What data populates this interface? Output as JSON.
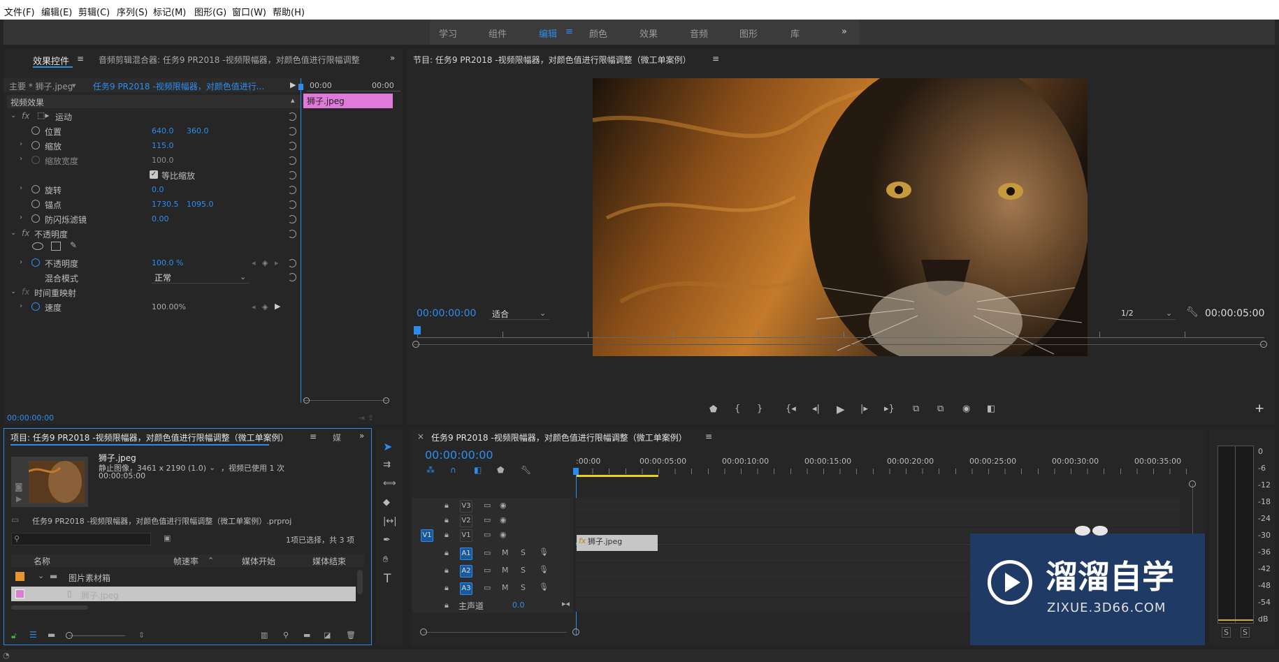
{
  "menu": [
    "文件(F)",
    "编辑(E)",
    "剪辑(C)",
    "序列(S)",
    "标记(M)",
    "图形(G)",
    "窗口(W)",
    "帮助(H)"
  ],
  "workspaces": [
    "学习",
    "组件",
    "编辑",
    "颜色",
    "效果",
    "音频",
    "图形",
    "库"
  ],
  "workspace_active": "编辑",
  "effect_controls": {
    "tab": "效果控件",
    "tab2": "音频剪辑混合器: 任务9 PR2018 -视频限幅器，对颜色值进行限幅调整",
    "master": "主要 * 狮子.jpeg",
    "sequence": "任务9 PR2018 -视频限幅器，对颜色值进行...",
    "time_start": "00:00",
    "time_end": "00:00",
    "clip": "狮子.jpeg",
    "section": "视频效果",
    "motion": "运动",
    "position_label": "位置",
    "position_x": "640.0",
    "position_y": "360.0",
    "scale_label": "缩放",
    "scale": "115.0",
    "scale_width_label": "缩放宽度",
    "scale_width": "100.0",
    "uniform_scale": "等比缩放",
    "rotation_label": "旋转",
    "rotation": "0.0",
    "anchor_label": "锚点",
    "anchor_x": "1730.5",
    "anchor_y": "1095.0",
    "flicker_label": "防闪烁滤镜",
    "flicker": "0.00",
    "opacity_group": "不透明度",
    "opacity_label": "不透明度",
    "opacity": "100.0 %",
    "blend_label": "混合模式",
    "blend": "正常",
    "time_remap": "时间重映射",
    "speed_label": "速度",
    "speed": "100.00%",
    "timecode": "00:00:00:00"
  },
  "program": {
    "title": "节目: 任务9 PR2018 -视频限幅器，对颜色值进行限幅调整（微工单案例）",
    "timecode": "00:00:00:00",
    "fit": "适合",
    "quality": "1/2",
    "duration": "00:00:05:00"
  },
  "project": {
    "tab": "项目: 任务9 PR2018 -视频限幅器，对颜色值进行限幅调整（微工单案例）",
    "tab2": "媒",
    "name": "狮子.jpeg",
    "info1": "静止图像，3461 x 2190 (1.0)",
    "info1b": "，视频已使用 1 次",
    "info2": "00:00:05:00",
    "file": "任务9 PR2018 -视频限幅器，对颜色值进行限幅调整（微工单案例）.prproj",
    "selection": "1项已选择，共 3 项",
    "columns": [
      "名称",
      "帧速率",
      "媒体开始",
      "媒体结束"
    ],
    "rows": [
      {
        "name": "图片素材箱",
        "color": "#e8962c"
      },
      {
        "name": "狮子.jpeg",
        "color": "#e07ad8"
      }
    ]
  },
  "timeline": {
    "title": "任务9 PR2018 -视频限幅器，对颜色值进行限幅调整（微工单案例）",
    "timecode": "00:00:00:00",
    "ruler": [
      ":00:00",
      "00:00:05:00",
      "00:00:10:00",
      "00:00:15:00",
      "00:00:20:00",
      "00:00:25:00",
      "00:00:30:00",
      "00:00:35:00"
    ],
    "tracks_video": [
      "V3",
      "V2",
      "V1"
    ],
    "tracks_audio": [
      "A1",
      "A2",
      "A3"
    ],
    "source_v": "V1",
    "master": "主声道",
    "master_val": "0.0",
    "clip": "狮子.jpeg"
  },
  "meter": [
    "0",
    "-6",
    "-12",
    "-18",
    "-24",
    "-30",
    "-36",
    "-42",
    "-48",
    "-54",
    "dB"
  ],
  "watermark": {
    "brand": "溜溜自学",
    "url": "ZIXUE.3D66.COM"
  },
  "colors": {
    "accent": "#2d8ceb",
    "clip_pink": "#e07ad8",
    "clip_gray": "#c6c6c6",
    "watermark_bg": "#1f3a64"
  }
}
